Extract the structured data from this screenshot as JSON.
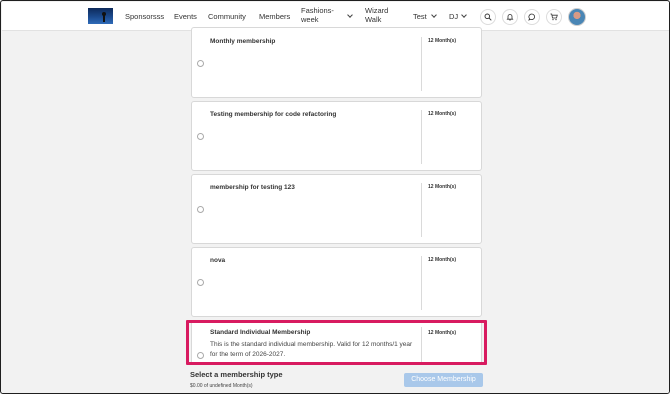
{
  "nav": {
    "items": [
      "Sponsorsss",
      "Events",
      "Community",
      "Members"
    ],
    "fashions": "Fashions-week",
    "wizard": "Wizard Walk",
    "test": "Test",
    "dj": "DJ"
  },
  "icons": {
    "search": "search-icon",
    "bell": "bell-icon",
    "chat": "chat-icon",
    "cart": "cart-icon"
  },
  "memberships": [
    {
      "title": "Monthly membership",
      "term": "12 Month(s)",
      "description": ""
    },
    {
      "title": "Testing membership for code refactoring",
      "term": "12 Month(s)",
      "description": ""
    },
    {
      "title": "membership for testing 123",
      "term": "12 Month(s)",
      "description": ""
    },
    {
      "title": "nova",
      "term": "12 Month(s)",
      "description": ""
    },
    {
      "title": "Standard Individual Membership",
      "term": "12 Month(s)",
      "description": "This is the standard individual membership. Valid for 12 months/1 year for the term of 2026-2027."
    }
  ],
  "footer": {
    "title": "Select a membership type",
    "subtitle": "$0.00 of undefined Month(s)",
    "button": "Choose Membership"
  },
  "colors": {
    "highlight": "#d81b60",
    "button": "#a9c8ea"
  }
}
